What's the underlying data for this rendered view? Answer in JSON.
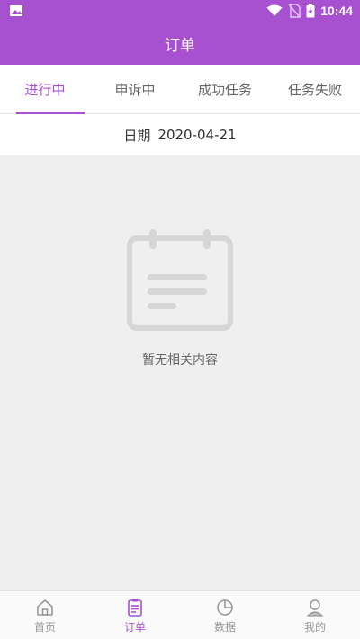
{
  "statusbar": {
    "time": "10:44"
  },
  "header": {
    "title": "订单"
  },
  "tabs": [
    {
      "label": "进行中",
      "active": true
    },
    {
      "label": "申诉中",
      "active": false
    },
    {
      "label": "成功任务",
      "active": false
    },
    {
      "label": "任务失败",
      "active": false
    }
  ],
  "date": {
    "label": "日期",
    "value": "2020-04-21"
  },
  "empty": {
    "text": "暂无相关内容"
  },
  "bottom_nav": [
    {
      "label": "首页",
      "icon": "home-icon",
      "active": false
    },
    {
      "label": "订单",
      "icon": "order-icon",
      "active": true
    },
    {
      "label": "数据",
      "icon": "pie-chart-icon",
      "active": false
    },
    {
      "label": "我的",
      "icon": "user-icon",
      "active": false
    }
  ],
  "colors": {
    "accent": "#a751d1",
    "background": "#efefef"
  }
}
